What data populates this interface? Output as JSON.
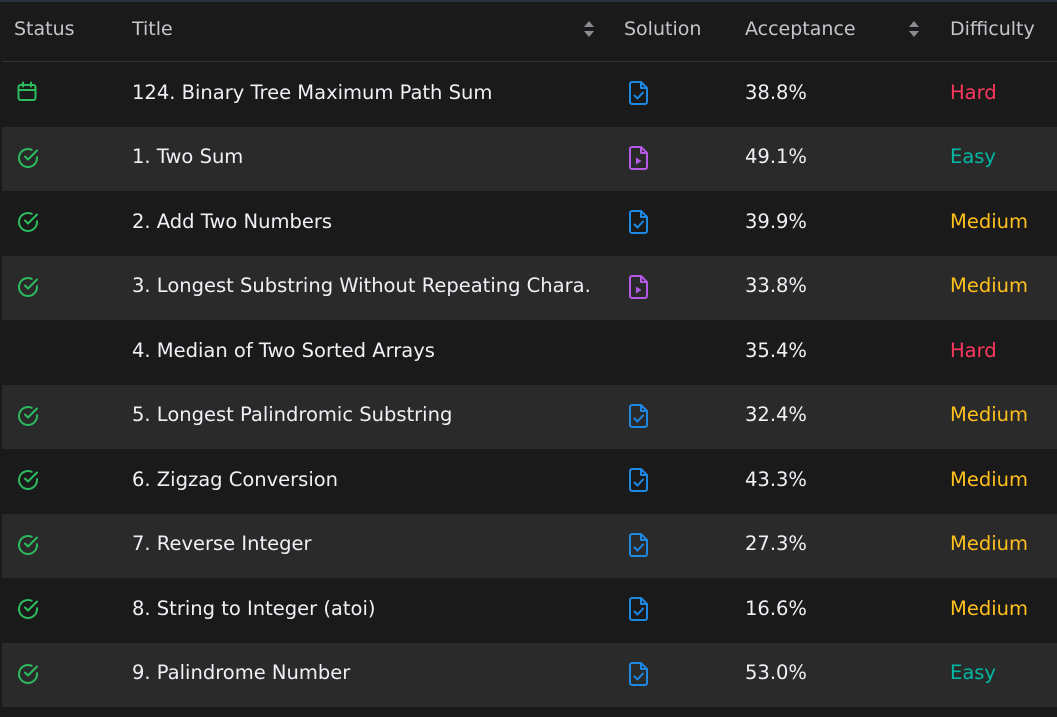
{
  "headers": {
    "status": "Status",
    "title": "Title",
    "solution": "Solution",
    "acceptance": "Acceptance",
    "difficulty": "Difficulty"
  },
  "colors": {
    "solved": "#2cbb5d",
    "article": "#1e88e5",
    "video": "#b559e9",
    "easy": "#00b8a3",
    "medium": "#ffc01e",
    "hard": "#ff375f"
  },
  "rows": [
    {
      "status": "calendar-icon",
      "title": "124. Binary Tree Maximum Path Sum",
      "solution": "article-icon",
      "acceptance": "38.8%",
      "difficulty": "Hard"
    },
    {
      "status": "check-circle-icon",
      "title": "1. Two Sum",
      "solution": "video-icon",
      "acceptance": "49.1%",
      "difficulty": "Easy"
    },
    {
      "status": "check-circle-icon",
      "title": "2. Add Two Numbers",
      "solution": "article-icon",
      "acceptance": "39.9%",
      "difficulty": "Medium"
    },
    {
      "status": "check-circle-icon",
      "title": "3. Longest Substring Without Repeating Chara...",
      "solution": "video-icon",
      "acceptance": "33.8%",
      "difficulty": "Medium"
    },
    {
      "status": "",
      "title": "4. Median of Two Sorted Arrays",
      "solution": "",
      "acceptance": "35.4%",
      "difficulty": "Hard"
    },
    {
      "status": "check-circle-icon",
      "title": "5. Longest Palindromic Substring",
      "solution": "article-icon",
      "acceptance": "32.4%",
      "difficulty": "Medium"
    },
    {
      "status": "check-circle-icon",
      "title": "6. Zigzag Conversion",
      "solution": "article-icon",
      "acceptance": "43.3%",
      "difficulty": "Medium"
    },
    {
      "status": "check-circle-icon",
      "title": "7. Reverse Integer",
      "solution": "article-icon",
      "acceptance": "27.3%",
      "difficulty": "Medium"
    },
    {
      "status": "check-circle-icon",
      "title": "8. String to Integer (atoi)",
      "solution": "article-icon",
      "acceptance": "16.6%",
      "difficulty": "Medium"
    },
    {
      "status": "check-circle-icon",
      "title": "9. Palindrome Number",
      "solution": "article-icon",
      "acceptance": "53.0%",
      "difficulty": "Easy"
    }
  ]
}
